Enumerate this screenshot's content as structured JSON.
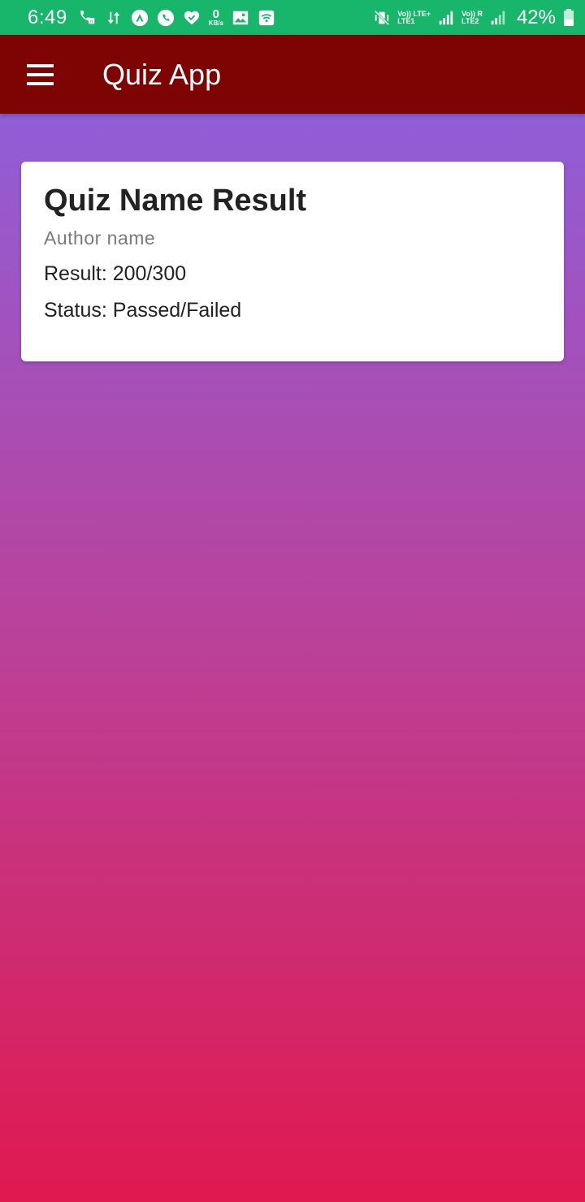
{
  "status_bar": {
    "time": "6:49",
    "speed_value": "0",
    "speed_unit": "KB/s",
    "sim1_top": "Vo)) LTE+",
    "sim1_bottom": "LTE1",
    "sim2_top": "Vo)) R",
    "sim2_bottom": "LTE2",
    "battery": "42%",
    "battery_level": 0.42,
    "icons": [
      "call-forward-icon",
      "data-transfer-icon",
      "app-a-icon",
      "whatsapp-icon",
      "heart-check-icon",
      "image-icon",
      "wifi-icon",
      "mute-vibrate-icon",
      "signal-icon"
    ],
    "color": "#17b66b"
  },
  "app_bar": {
    "title": "Quiz App",
    "menu_icon": "hamburger-menu-icon",
    "color": "#7e0404"
  },
  "result_card": {
    "title": "Quiz Name Result",
    "author": "Author name",
    "result_line": "Result: 200/300",
    "status_line": "Status: Passed/Failed"
  },
  "background": {
    "gradient_top": "#905ed7",
    "gradient_bottom": "#e0194f"
  }
}
